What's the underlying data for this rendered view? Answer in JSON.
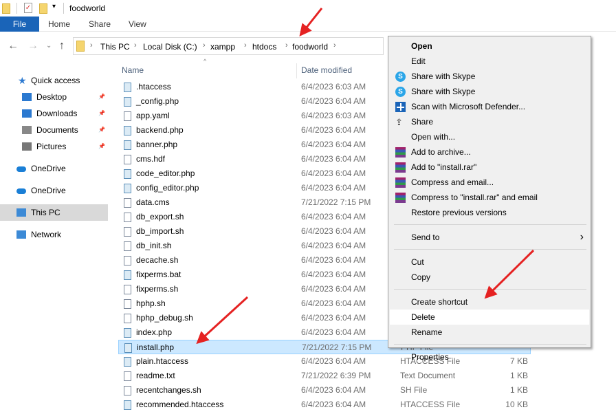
{
  "window": {
    "title": "foodworld"
  },
  "ribbon": {
    "tabs": [
      "File",
      "Home",
      "Share",
      "View"
    ]
  },
  "address": {
    "crumbs": [
      "This PC",
      "Local Disk (C:)",
      "xampp",
      "htdocs",
      "foodworld"
    ]
  },
  "nav": {
    "items": [
      {
        "label": "Quick access",
        "icon": "star-icon"
      },
      {
        "label": "Desktop",
        "icon": "desktop-icon",
        "pinned": true
      },
      {
        "label": "Downloads",
        "icon": "download-icon",
        "pinned": true
      },
      {
        "label": "Documents",
        "icon": "documents-icon",
        "pinned": true
      },
      {
        "label": "Pictures",
        "icon": "pictures-icon",
        "pinned": true
      },
      {
        "label": "OneDrive",
        "icon": "cloud-icon"
      },
      {
        "label": "OneDrive",
        "icon": "cloud-icon"
      },
      {
        "label": "This PC",
        "icon": "computer-icon",
        "selected": true
      },
      {
        "label": "Network",
        "icon": "network-icon"
      }
    ]
  },
  "columns": {
    "name": "Name",
    "date": "Date modified"
  },
  "files": [
    {
      "name": ".htaccess",
      "date": "6/4/2023 6:03 AM",
      "type": "",
      "size": ""
    },
    {
      "name": "_config.php",
      "date": "6/4/2023 6:04 AM",
      "type": "",
      "size": ""
    },
    {
      "name": "app.yaml",
      "date": "6/4/2023 6:03 AM",
      "type": "",
      "size": ""
    },
    {
      "name": "backend.php",
      "date": "6/4/2023 6:04 AM",
      "type": "",
      "size": ""
    },
    {
      "name": "banner.php",
      "date": "6/4/2023 6:04 AM",
      "type": "",
      "size": ""
    },
    {
      "name": "cms.hdf",
      "date": "6/4/2023 6:04 AM",
      "type": "",
      "size": ""
    },
    {
      "name": "code_editor.php",
      "date": "6/4/2023 6:04 AM",
      "type": "",
      "size": ""
    },
    {
      "name": "config_editor.php",
      "date": "6/4/2023 6:04 AM",
      "type": "",
      "size": ""
    },
    {
      "name": "data.cms",
      "date": "7/21/2022 7:15 PM",
      "type": "",
      "size": ""
    },
    {
      "name": "db_export.sh",
      "date": "6/4/2023 6:04 AM",
      "type": "",
      "size": ""
    },
    {
      "name": "db_import.sh",
      "date": "6/4/2023 6:04 AM",
      "type": "",
      "size": ""
    },
    {
      "name": "db_init.sh",
      "date": "6/4/2023 6:04 AM",
      "type": "",
      "size": ""
    },
    {
      "name": "decache.sh",
      "date": "6/4/2023 6:04 AM",
      "type": "",
      "size": ""
    },
    {
      "name": "fixperms.bat",
      "date": "6/4/2023 6:04 AM",
      "type": "",
      "size": ""
    },
    {
      "name": "fixperms.sh",
      "date": "6/4/2023 6:04 AM",
      "type": "",
      "size": ""
    },
    {
      "name": "hphp.sh",
      "date": "6/4/2023 6:04 AM",
      "type": "",
      "size": ""
    },
    {
      "name": "hphp_debug.sh",
      "date": "6/4/2023 6:04 AM",
      "type": "",
      "size": ""
    },
    {
      "name": "index.php",
      "date": "6/4/2023 6:04 AM",
      "type": "",
      "size": ""
    },
    {
      "name": "install.php",
      "date": "7/21/2022 7:15 PM",
      "type": "PHP File",
      "size": "",
      "selected": true
    },
    {
      "name": "plain.htaccess",
      "date": "6/4/2023 6:04 AM",
      "type": "HTACCESS File",
      "size": "7 KB"
    },
    {
      "name": "readme.txt",
      "date": "7/21/2022 6:39 PM",
      "type": "Text Document",
      "size": "1 KB"
    },
    {
      "name": "recentchanges.sh",
      "date": "6/4/2023 6:04 AM",
      "type": "SH File",
      "size": "1 KB"
    },
    {
      "name": "recommended.htaccess",
      "date": "6/4/2023 6:04 AM",
      "type": "HTACCESS File",
      "size": "10 KB"
    }
  ],
  "context_menu": {
    "items": [
      {
        "label": "Open",
        "bold": true
      },
      {
        "label": "Edit"
      },
      {
        "label": "Share with Skype",
        "icon": "skype-icon"
      },
      {
        "label": "Share with Skype",
        "icon": "skype-icon"
      },
      {
        "label": "Scan with Microsoft Defender...",
        "icon": "defender-shield-icon"
      },
      {
        "label": "Share",
        "icon": "share-icon"
      },
      {
        "label": "Open with..."
      },
      {
        "label": "Add to archive...",
        "icon": "winrar-icon"
      },
      {
        "label": "Add to \"install.rar\"",
        "icon": "winrar-icon"
      },
      {
        "label": "Compress and email...",
        "icon": "winrar-icon"
      },
      {
        "label": "Compress to \"install.rar\" and email",
        "icon": "winrar-icon"
      },
      {
        "label": "Restore previous versions"
      },
      {
        "separator": true
      },
      {
        "label": "Send to",
        "submenu": true
      },
      {
        "separator": true
      },
      {
        "label": "Cut"
      },
      {
        "label": "Copy"
      },
      {
        "separator": true
      },
      {
        "label": "Create shortcut"
      },
      {
        "label": "Delete",
        "hover": true
      },
      {
        "label": "Rename"
      },
      {
        "separator": true
      },
      {
        "label": "Properties"
      }
    ]
  },
  "colors": {
    "accent": "#1a64b8",
    "selection": "#cce8ff",
    "annotation_arrow": "#e52222"
  }
}
